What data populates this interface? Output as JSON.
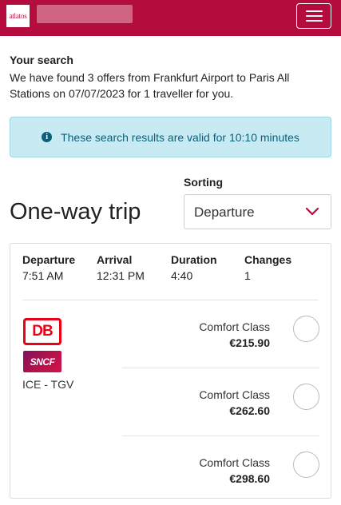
{
  "header": {
    "logo_text": "atlatos",
    "menu_icon": "hamburger-icon",
    "brand_color": "#b40c3c"
  },
  "search": {
    "title": "Your search",
    "description": "We have found 3 offers from Frankfurt Airport to Paris All Stations on 07/07/2023 for 1 traveller for you."
  },
  "alert": {
    "icon": "info-icon",
    "text": "These search results are valid for 10:10 minutes"
  },
  "sorting": {
    "label": "Sorting",
    "selected": "Departure",
    "chevron": "chevron-down-icon"
  },
  "trip": {
    "heading": "One-way trip",
    "summary": [
      {
        "label": "Departure",
        "value": "7:51 AM"
      },
      {
        "label": "Arrival",
        "value": "12:31 PM"
      },
      {
        "label": "Duration",
        "value": "4:40"
      },
      {
        "label": "Changes",
        "value": "1"
      }
    ],
    "operators": [
      "DB",
      "SNCF"
    ],
    "train_type": "ICE - TGV",
    "offers": [
      {
        "class": "Comfort Class",
        "price": "€215.90"
      },
      {
        "class": "Comfort Class",
        "price": "€262.60"
      },
      {
        "class": "Comfort Class",
        "price": "€298.60"
      }
    ]
  }
}
